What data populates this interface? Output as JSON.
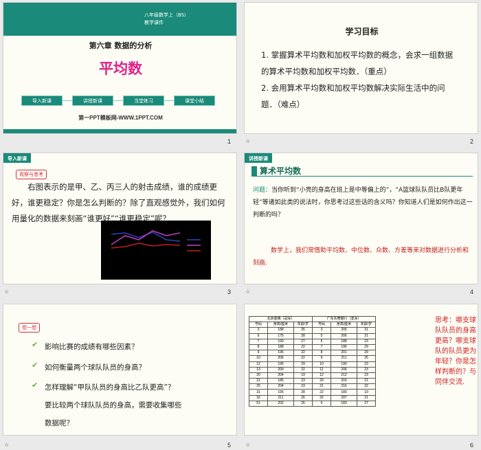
{
  "slide1": {
    "grade": "八年级数学上（BS）",
    "type": "教学课件",
    "chapter": "第六章  数据的分析",
    "title": "平均数",
    "buttons": [
      "导入新课",
      "讲授新课",
      "当堂练习",
      "课堂小结"
    ],
    "website": "第一PPT模板网-WWW.1PPT.COM",
    "number": "1"
  },
  "slide2": {
    "title": "学习目标",
    "items": [
      "1. 掌握算术平均数和加权平均数的概念，会求一组数据的算术平均数和加权平均数．（重点）",
      "2. 会用算术平均数和加权平均数解决实际生活中的问题．（难点）"
    ],
    "number": "2",
    "star": "☆"
  },
  "slide3": {
    "header": "导入新课",
    "tag": "观察与思考",
    "text": "右图表示的是甲、乙、丙三人的射击成绩，谁的成绩更好，谁更稳定？你是怎么判断的？除了直观感觉外，我们如何用量化的数据来刻画“谁更好”“谁更稳定”呢？",
    "number": "3",
    "star": "☆"
  },
  "slide4": {
    "header": "讲授新课",
    "title": "算术平均数",
    "q_label": "问题：",
    "question": "当你听到“小亮的身高在班上是中等偏上的”，“A篮球队队员比B队更年轻”等诸如此类的说法时，你思考过这些话的含义吗？你知道人们是如何作出这一判断的吗？",
    "remark": "数学上，我们常借助平均数、中位数、众数、方差等来对数据进行分析和刻画.",
    "number": "4",
    "star": "☆"
  },
  "slide5": {
    "tag": "想一想",
    "items": [
      "影响比赛的成绩有哪些因素？",
      "如何衡量两个球队队员的身高？",
      "怎样理解“甲队队员的身高比乙队更高”？"
    ],
    "extra": [
      "要比较两个球队队员的身高，需要收集哪些",
      "数据呢？"
    ],
    "number": "5",
    "star": "☆"
  },
  "slide6": {
    "table_left_title": "北京金隅（冠军）",
    "table_right_title": "广东东莞银行（亚军）",
    "headers": [
      "号码",
      "身高/厘米",
      "年龄/岁",
      "号码",
      "身高/厘米",
      "年龄/岁"
    ],
    "rows": [
      [
        "3",
        "188",
        "35",
        "3",
        "205",
        "31"
      ],
      [
        "6",
        "175",
        "28",
        "5",
        "206",
        "21"
      ],
      [
        "7",
        "190",
        "27",
        "6",
        "188",
        "23"
      ],
      [
        "8",
        "188",
        "22",
        "7",
        "196",
        "29"
      ],
      [
        "9",
        "196",
        "22",
        "8",
        "201",
        "29"
      ],
      [
        "10",
        "206",
        "22",
        "9",
        "211",
        "25"
      ],
      [
        "12",
        "195",
        "29",
        "10",
        "190",
        "23"
      ],
      [
        "13",
        "209",
        "22",
        "11",
        "206",
        "23"
      ],
      [
        "20",
        "204",
        "19",
        "12",
        "212",
        "23"
      ],
      [
        "21",
        "185",
        "23",
        "20",
        "203",
        "21"
      ],
      [
        "25",
        "204",
        "23",
        "21",
        "216",
        "22"
      ],
      [
        "31",
        "195",
        "28",
        "22",
        "180",
        "19"
      ],
      [
        "32",
        "211",
        "26",
        "32",
        "207",
        "21"
      ],
      [
        "51",
        "202",
        "26",
        "0",
        "183",
        "27"
      ]
    ],
    "note": "思考：哪支球队队员的身高更高？哪支球队的队员更为年轻？你是怎样判断的？与同伴交流.",
    "number": "6",
    "star": "☆"
  },
  "colors": {
    "accent": "#1a8a7a",
    "title_pink": "#e0218a",
    "red": "#d02020"
  }
}
